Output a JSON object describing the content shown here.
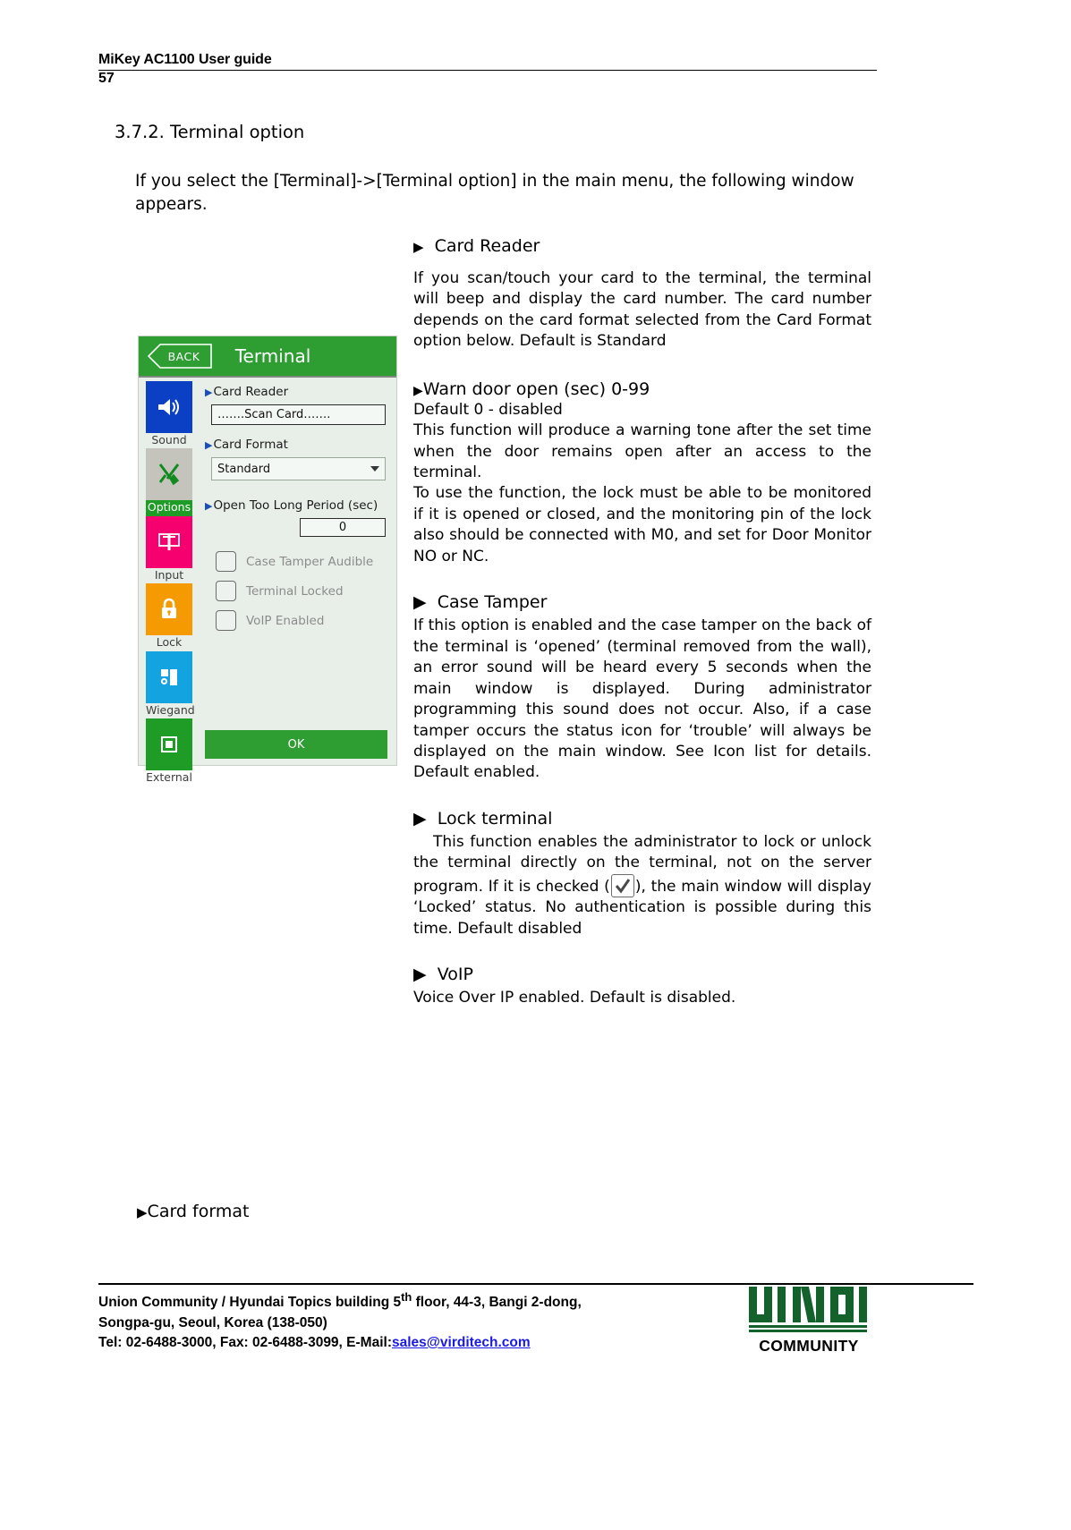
{
  "header": {
    "title": "MiKey AC1100 User guide",
    "page_number": "57"
  },
  "section": {
    "heading": "3.7.2. Terminal option",
    "intro": "If you select the [Terminal]->[Terminal option] in the main menu, the following window appears."
  },
  "terminal_window": {
    "back_label": "BACK",
    "title": "Terminal",
    "sidebar": [
      {
        "label": "Sound",
        "icon": "speaker-icon",
        "color": "#0b3fc4",
        "highlight": false
      },
      {
        "label": "Options",
        "icon": "tools-icon",
        "color": "#c4c4bd",
        "highlight": true
      },
      {
        "label": "Input",
        "icon": "keypad-icon",
        "color": "#f5006e",
        "highlight": false
      },
      {
        "label": "Lock",
        "icon": "padlock-icon",
        "color": "#f59a00",
        "highlight": false
      },
      {
        "label": "Wiegand",
        "icon": "wiegand-icon",
        "color": "#12a3e0",
        "highlight": false
      },
      {
        "label": "External",
        "icon": "external-icon",
        "color": "#1f9c26",
        "highlight": false
      }
    ],
    "card_reader_label": "Card Reader",
    "card_reader_value": "…….Scan Card…….",
    "card_format_label": "Card Format",
    "card_format_value": "Standard",
    "open_too_long_label": "Open Too Long Period (sec)",
    "open_too_long_value": "0",
    "checkboxes": [
      {
        "label": "Case Tamper Audible",
        "checked": false
      },
      {
        "label": "Terminal Locked",
        "checked": false
      },
      {
        "label": "VoIP Enabled",
        "checked": false
      }
    ],
    "ok_label": "OK"
  },
  "content": {
    "card_reader": {
      "heading": "Card Reader",
      "body": "If you scan/touch your card to the terminal, the terminal will beep and display the card number. The card number depends on the card format selected from the Card Format option below. Default is Standard"
    },
    "warn_door": {
      "heading": "Warn door open (sec) 0-99",
      "line1": "Default 0 - disabled",
      "line2": "This function will produce a warning tone after the set time when the door remains open after an access to the terminal.",
      "line3": "To use the function, the lock must be able to be monitored if it is opened or closed, and the monitoring pin of the lock also should be connected with M0, and set for Door Monitor NO or NC."
    },
    "case_tamper": {
      "heading": "Case Tamper",
      "body": "If this option is enabled and the case tamper on the back of the terminal is ‘opened’ (terminal removed from the wall), an error sound will be heard every 5 seconds when the main window is displayed. During administrator programming this sound does not occur. Also, if a case tamper occurs the status icon for ‘trouble’ will always be displayed on the main window. See Icon list for details. Default enabled."
    },
    "lock_terminal": {
      "heading": "Lock terminal",
      "part1": "This function enables the administrator to lock or unlock the terminal directly on the terminal, not on the server program.   If it is checked (",
      "part2": "), the main window will display ‘Locked’ status. No authentication is possible during this time. Default disabled"
    },
    "voip": {
      "heading": "VoIP",
      "body": "Voice Over IP enabled. Default is disabled."
    },
    "card_format_line": "Card format"
  },
  "footer": {
    "line1_a": "Union Community / Hyundai Topics building 5",
    "line1_sup": "th",
    "line1_b": " floor, 44-3, Bangi 2-dong,",
    "line2": "Songpa-gu, Seoul, Korea (138-050)",
    "line3_a": "Tel: 02-6488-3000, Fax: 02-6488-3099, E-Mail:",
    "line3_mail": "sales@virditech.com",
    "logo_word": "COMMUNITY",
    "logo_mark_text": "UNION",
    "logo_color": "#13622b"
  }
}
